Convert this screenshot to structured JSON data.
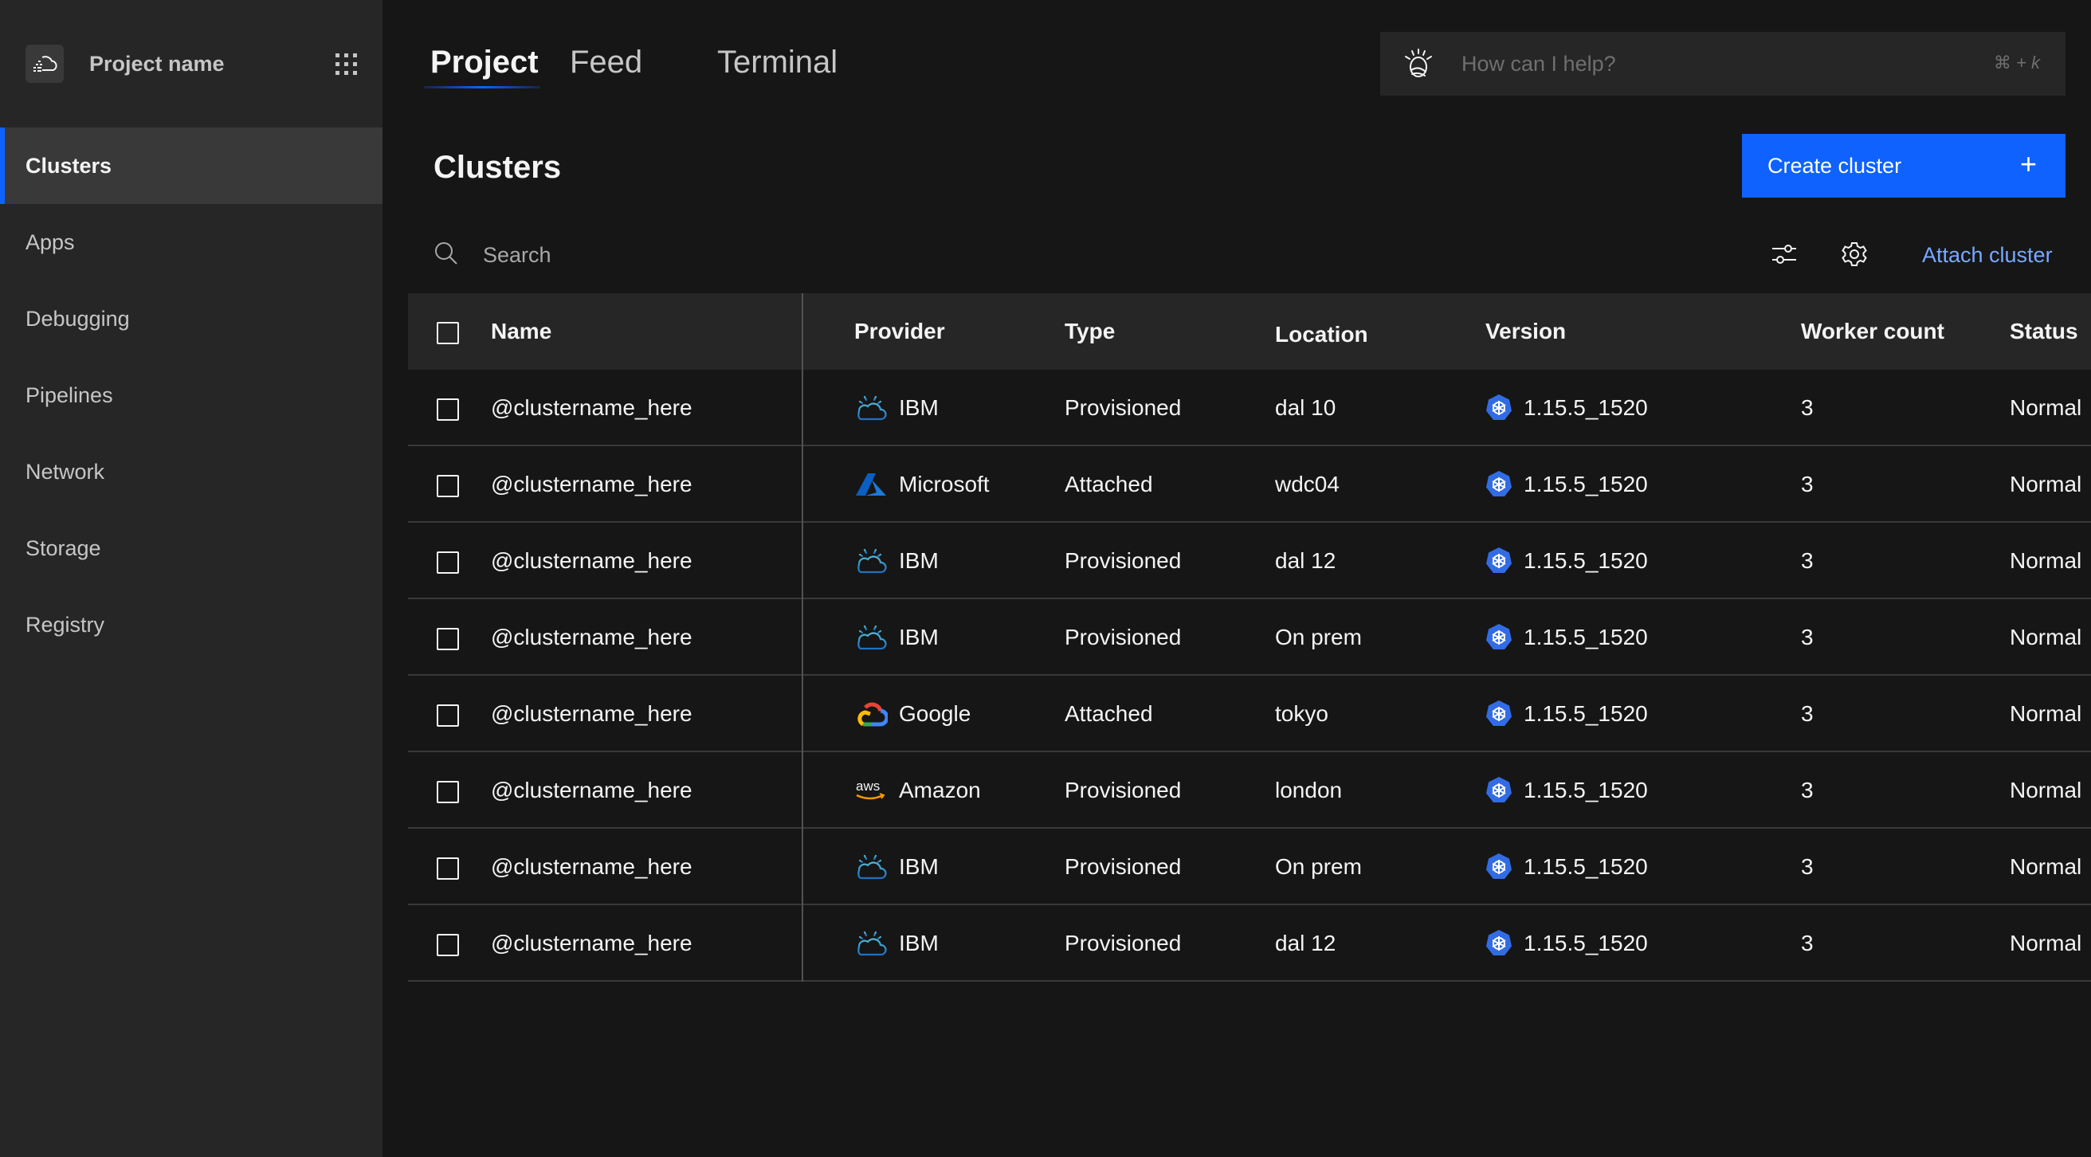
{
  "sidebar": {
    "project_name": "Project name",
    "items": [
      {
        "label": "Clusters",
        "active": true
      },
      {
        "label": "Apps",
        "active": false
      },
      {
        "label": "Debugging",
        "active": false
      },
      {
        "label": "Pipelines",
        "active": false
      },
      {
        "label": "Network",
        "active": false
      },
      {
        "label": "Storage",
        "active": false
      },
      {
        "label": "Registry",
        "active": false
      }
    ]
  },
  "tabs": [
    {
      "label": "Project",
      "active": true
    },
    {
      "label": "Feed",
      "active": false
    },
    {
      "label": "Terminal",
      "active": false
    }
  ],
  "help": {
    "placeholder": "How can I help?",
    "shortcut": "⌘ + k"
  },
  "page": {
    "title": "Clusters",
    "create_button": "Create cluster",
    "create_icon": "+",
    "search_placeholder": "Search",
    "attach_link": "Attach cluster"
  },
  "colors": {
    "accent": "#0f62fe",
    "link": "#78a9ff",
    "sidebar_bg": "#262626",
    "main_bg": "#161616"
  },
  "table": {
    "headers": {
      "name": "Name",
      "provider": "Provider",
      "type": "Type",
      "location": "Location",
      "version": "Version",
      "worker_count": "Worker count",
      "status": "Status"
    },
    "rows": [
      {
        "name": "@clustername_here",
        "provider": "IBM",
        "provider_icon": "ibm-cloud-icon",
        "type": "Provisioned",
        "location": "dal 10",
        "version": "1.15.5_1520",
        "worker_count": "3",
        "status": "Normal"
      },
      {
        "name": "@clustername_here",
        "provider": "Microsoft",
        "provider_icon": "azure-icon",
        "type": "Attached",
        "location": "wdc04",
        "version": "1.15.5_1520",
        "worker_count": "3",
        "status": "Normal"
      },
      {
        "name": "@clustername_here",
        "provider": "IBM",
        "provider_icon": "ibm-cloud-icon",
        "type": "Provisioned",
        "location": "dal 12",
        "version": "1.15.5_1520",
        "worker_count": "3",
        "status": "Normal"
      },
      {
        "name": "@clustername_here",
        "provider": "IBM",
        "provider_icon": "ibm-cloud-icon",
        "type": "Provisioned",
        "location": "On prem",
        "version": "1.15.5_1520",
        "worker_count": "3",
        "status": "Normal"
      },
      {
        "name": "@clustername_here",
        "provider": "Google",
        "provider_icon": "google-cloud-icon",
        "type": "Attached",
        "location": "tokyo",
        "version": "1.15.5_1520",
        "worker_count": "3",
        "status": "Normal"
      },
      {
        "name": "@clustername_here",
        "provider": "Amazon",
        "provider_icon": "aws-icon",
        "type": "Provisioned",
        "location": "london",
        "version": "1.15.5_1520",
        "worker_count": "3",
        "status": "Normal"
      },
      {
        "name": "@clustername_here",
        "provider": "IBM",
        "provider_icon": "ibm-cloud-icon",
        "type": "Provisioned",
        "location": "On prem",
        "version": "1.15.5_1520",
        "worker_count": "3",
        "status": "Normal"
      },
      {
        "name": "@clustername_here",
        "provider": "IBM",
        "provider_icon": "ibm-cloud-icon",
        "type": "Provisioned",
        "location": "dal 12",
        "version": "1.15.5_1520",
        "worker_count": "3",
        "status": "Normal"
      }
    ]
  }
}
